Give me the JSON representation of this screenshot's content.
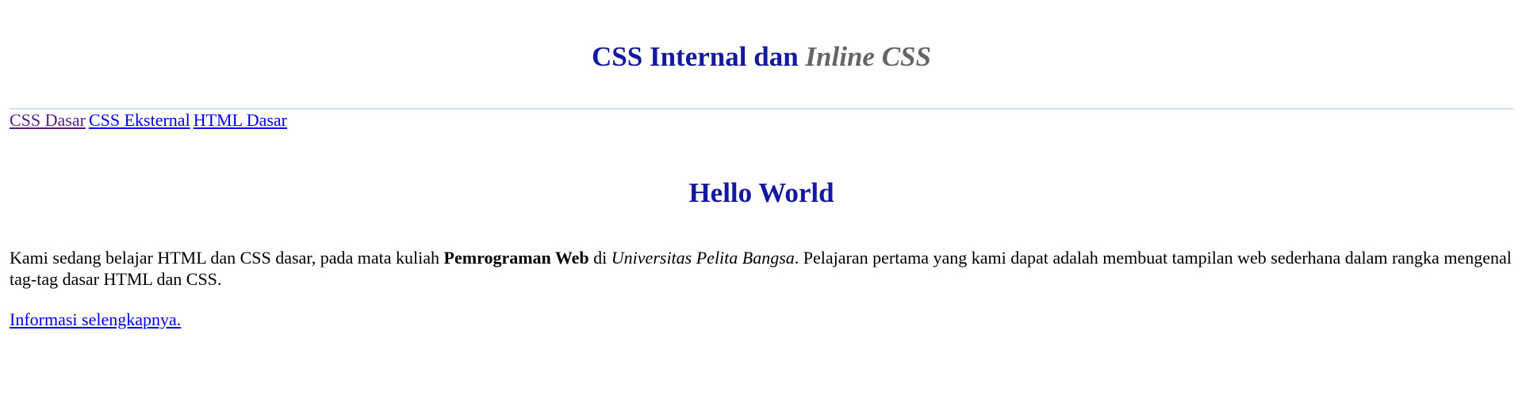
{
  "header": {
    "title_main": "CSS Internal dan ",
    "title_accent": "Inline CSS"
  },
  "nav": {
    "links": [
      {
        "label": "CSS Dasar",
        "state": "visited"
      },
      {
        "label": "CSS Eksternal",
        "state": "unvisited"
      },
      {
        "label": "HTML Dasar",
        "state": "unvisited"
      }
    ]
  },
  "main": {
    "heading": "Hello World",
    "paragraph": {
      "part1": "Kami sedang belajar HTML dan CSS dasar, pada mata kuliah ",
      "bold": "Pemrograman Web",
      "part2": " di ",
      "italic": "Universitas Pelita Bangsa",
      "part3": ". Pelajaran pertama yang kami dapat adalah membuat tampilan web sederhana dalam rangka mengenal tag-tag dasar HTML dan CSS."
    },
    "more_link": "Informasi selengkapnya."
  },
  "colors": {
    "heading": "#141aa0",
    "accent": "#666666",
    "link": "#0000ee",
    "link_visited": "#551a8b",
    "divider": "#9fd0dc"
  }
}
